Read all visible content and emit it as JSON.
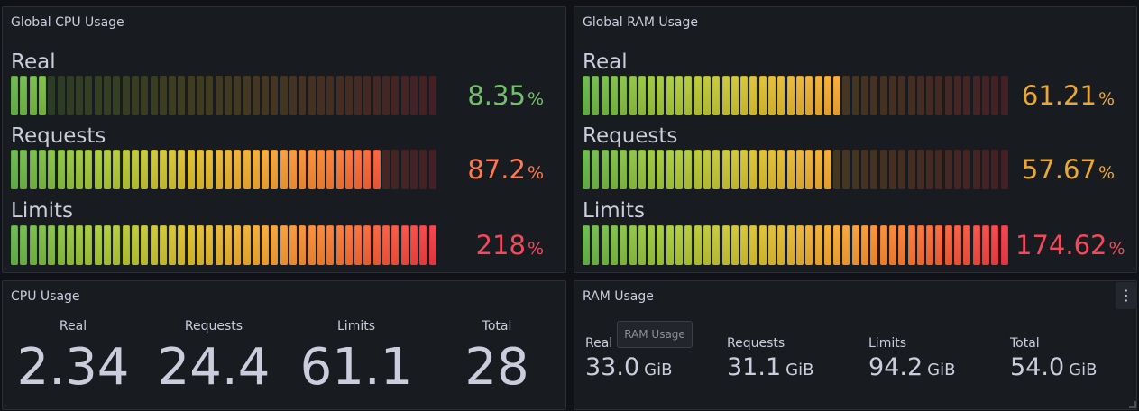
{
  "panels": {
    "cpu_global": {
      "title": "Global CPU Usage",
      "rows": [
        {
          "label": "Real",
          "value": "8.35",
          "unit": "%",
          "fraction": 0.0835,
          "color": "#73bf69"
        },
        {
          "label": "Requests",
          "value": "87.2",
          "unit": "%",
          "fraction": 0.872,
          "color": "#ff7850"
        },
        {
          "label": "Limits",
          "value": "218",
          "unit": "%",
          "fraction": 1.0,
          "color": "#f2495c"
        }
      ]
    },
    "ram_global": {
      "title": "Global RAM Usage",
      "rows": [
        {
          "label": "Real",
          "value": "61.21",
          "unit": "%",
          "fraction": 0.6121,
          "color": "#e8a838"
        },
        {
          "label": "Requests",
          "value": "57.67",
          "unit": "%",
          "fraction": 0.5767,
          "color": "#e8a838"
        },
        {
          "label": "Limits",
          "value": "174.62",
          "unit": "%",
          "fraction": 1.0,
          "color": "#f2495c"
        }
      ]
    },
    "cpu_usage": {
      "title": "CPU Usage",
      "stats": [
        {
          "label": "Real",
          "value": "2.34"
        },
        {
          "label": "Requests",
          "value": "24.4"
        },
        {
          "label": "Limits",
          "value": "61.1"
        },
        {
          "label": "Total",
          "value": "28"
        }
      ]
    },
    "ram_usage": {
      "title": "RAM Usage",
      "tooltip": "RAM Usage",
      "menu_icon": "vertical-ellipsis-icon",
      "stats": [
        {
          "label": "Real",
          "value": "33.0",
          "unit": "GiB"
        },
        {
          "label": "Requests",
          "value": "31.1",
          "unit": "GiB"
        },
        {
          "label": "Limits",
          "value": "94.2",
          "unit": "GiB"
        },
        {
          "label": "Total",
          "value": "54.0",
          "unit": "GiB"
        }
      ]
    }
  },
  "gauge_gradient": [
    "#5fa843",
    "#9bbb32",
    "#c9b32a",
    "#e39a2e",
    "#e6672d",
    "#e0343f"
  ]
}
